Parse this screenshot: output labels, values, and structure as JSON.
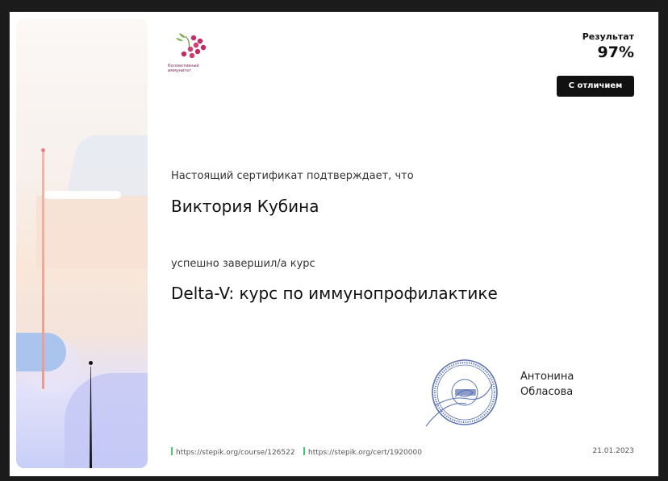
{
  "logo": {
    "caption_line1": "Коллективный",
    "caption_line2": "иммунитет"
  },
  "result": {
    "label": "Результат",
    "value": "97%",
    "badge": "С отличием"
  },
  "certificate": {
    "intro": "Настоящий сертификат подтверждает, что",
    "recipient": "Виктория Кубина",
    "completed_text": "успешно завершил/а  курс",
    "course_title": "Delta-V: курс по иммунопрофилактике"
  },
  "signer": {
    "first_name": "Антонина",
    "last_name": "Обласова"
  },
  "stamp": {
    "center_text": "«Коллективный иммунитет»",
    "ring_text": "Санкт-Петербург"
  },
  "footer": {
    "course_url": "https://stepik.org/course/126522",
    "cert_url": "https://stepik.org/cert/1920000",
    "date": "21.01.2023"
  },
  "colors": {
    "accent_link_marker": "#4cc26b",
    "logo_berry": "#c42a63",
    "badge_bg": "#111111"
  }
}
